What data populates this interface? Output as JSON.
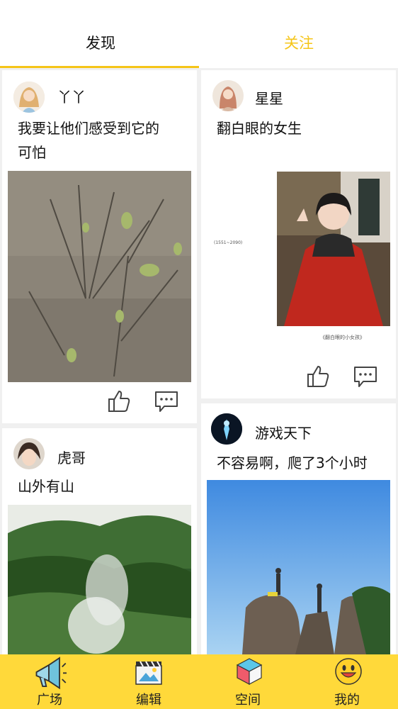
{
  "tabs": {
    "discover": "发现",
    "follow": "关注"
  },
  "posts": [
    {
      "user": "丫丫",
      "text_lines": [
        "我要让他们感受到它的",
        "可怕"
      ]
    },
    {
      "user": "星星",
      "text_lines": [
        "翻白眼的女生"
      ],
      "caption_left": "(1551~2090)",
      "caption_right": "《翻白眼的小女孩》"
    },
    {
      "user": "虎哥",
      "text_lines": [
        "山外有山"
      ]
    },
    {
      "user": "游戏天下",
      "text_lines": [
        "不容易啊，爬了3个小时"
      ]
    }
  ],
  "nav": [
    {
      "label": "广场",
      "icon": "megaphone-icon"
    },
    {
      "label": "编辑",
      "icon": "clapperboard-icon"
    },
    {
      "label": "空间",
      "icon": "cube-icon"
    },
    {
      "label": "我的",
      "icon": "smiley-icon"
    }
  ],
  "colors": {
    "accent": "#f5c518",
    "nav_bg": "#ffd93a"
  }
}
